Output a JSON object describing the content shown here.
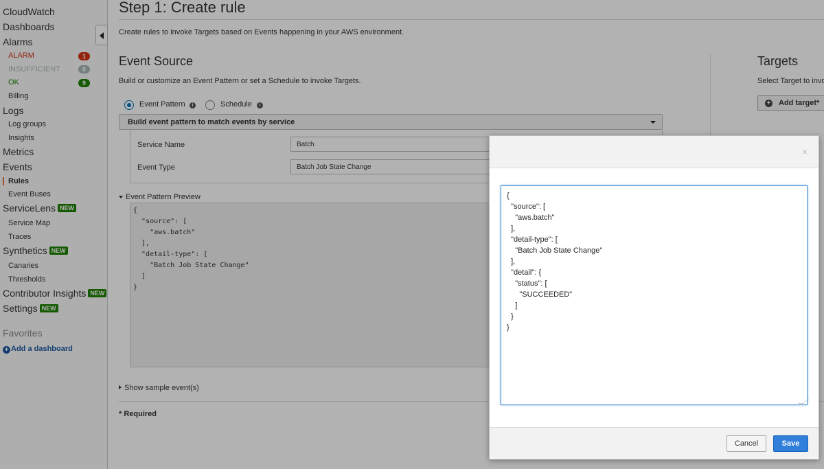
{
  "sidebar": {
    "cloudwatch": "CloudWatch",
    "dashboards": "Dashboards",
    "alarms": "Alarms",
    "alarm_states": [
      {
        "label": "ALARM",
        "count": "1",
        "color": "#d13212"
      },
      {
        "label": "INSUFFICIENT",
        "count": "0",
        "color": "#aab7b8"
      },
      {
        "label": "OK",
        "count": "9",
        "color": "#1d8102"
      }
    ],
    "billing": "Billing",
    "logs": "Logs",
    "log_groups": "Log groups",
    "insights": "Insights",
    "metrics": "Metrics",
    "events": "Events",
    "rules": "Rules",
    "event_buses": "Event Buses",
    "servicelens": "ServiceLens",
    "service_map": "Service Map",
    "traces": "Traces",
    "synthetics": "Synthetics",
    "canaries": "Canaries",
    "thresholds": "Thresholds",
    "contributor_insights": "Contributor Insights",
    "settings": "Settings",
    "new_badge": "NEW",
    "favorites": "Favorites",
    "add_dashboard": "Add a dashboard"
  },
  "main": {
    "title": "Step 1: Create rule",
    "description": "Create rules to invoke Targets based on Events happening in your AWS environment.",
    "event_source": {
      "heading": "Event Source",
      "description": "Build or customize an Event Pattern or set a Schedule to invoke Targets.",
      "radio_event_pattern": "Event Pattern",
      "radio_schedule": "Schedule",
      "pattern_select": "Build event pattern to match events by service",
      "service_name_label": "Service Name",
      "service_name_value": "Batch",
      "event_type_label": "Event Type",
      "event_type_value": "Batch Job State Change",
      "preview_label": "Event Pattern Preview",
      "preview_text": "{\n  \"source\": [\n    \"aws.batch\"\n  ],\n  \"detail-type\": [\n    \"Batch Job State Change\"\n  ]\n}",
      "show_sample": "Show sample event(s)",
      "required": "* Required"
    },
    "targets": {
      "heading": "Targets",
      "description": "Select Target to invo",
      "add_target": "Add target*"
    }
  },
  "modal": {
    "close": "×",
    "json_text": "{\n  \"source\": [\n    \"aws.batch\"\n  ],\n  \"detail-type\": [\n    \"Batch Job State Change\"\n  ],\n  \"detail\": {\n    \"status\": [\n      \"SUCCEEDED\"\n    ]\n  }\n}",
    "cancel": "Cancel",
    "save": "Save"
  }
}
